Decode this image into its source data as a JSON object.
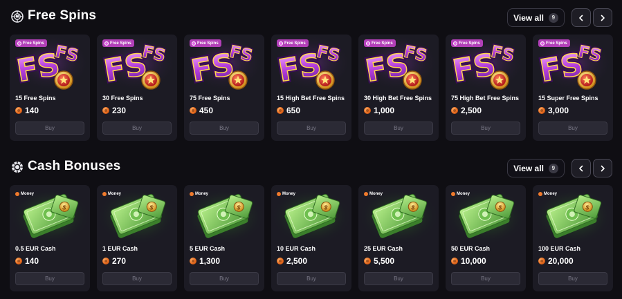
{
  "colors": {
    "background": "#0f0e13",
    "card": "#1c1b24",
    "badge_spins": "#b23fb8",
    "coin": "#e76a1e",
    "buy_button": "#2b2a35"
  },
  "free_spins": {
    "title": "Free Spins",
    "icon": "crown-wheel-icon",
    "view_all_label": "View all",
    "view_all_count": "9",
    "prev_icon": "chevron-left-icon",
    "next_icon": "chevron-right-icon",
    "badge": "Free Spins",
    "buy_label": "Buy",
    "items": [
      {
        "name": "15 Free Spins",
        "price": "140"
      },
      {
        "name": "30 Free Spins",
        "price": "230"
      },
      {
        "name": "75 Free Spins",
        "price": "450"
      },
      {
        "name": "15 High Bet Free Spins",
        "price": "650"
      },
      {
        "name": "30 High Bet Free Spins",
        "price": "1,000"
      },
      {
        "name": "75 High Bet Free Spins",
        "price": "2,500"
      },
      {
        "name": "15 Super Free Spins",
        "price": "3,000"
      }
    ]
  },
  "cash_bonuses": {
    "title": "Cash Bonuses",
    "icon": "chip-icon",
    "view_all_label": "View all",
    "view_all_count": "9",
    "prev_icon": "chevron-left-icon",
    "next_icon": "chevron-right-icon",
    "badge": "Money",
    "buy_label": "Buy",
    "items": [
      {
        "name": "0.5 EUR Cash",
        "price": "140"
      },
      {
        "name": "1 EUR Cash",
        "price": "270"
      },
      {
        "name": "5 EUR Cash",
        "price": "1,300"
      },
      {
        "name": "10 EUR Cash",
        "price": "2,500"
      },
      {
        "name": "25 EUR Cash",
        "price": "5,500"
      },
      {
        "name": "50 EUR Cash",
        "price": "10,000"
      },
      {
        "name": "100 EUR Cash",
        "price": "20,000"
      }
    ]
  }
}
